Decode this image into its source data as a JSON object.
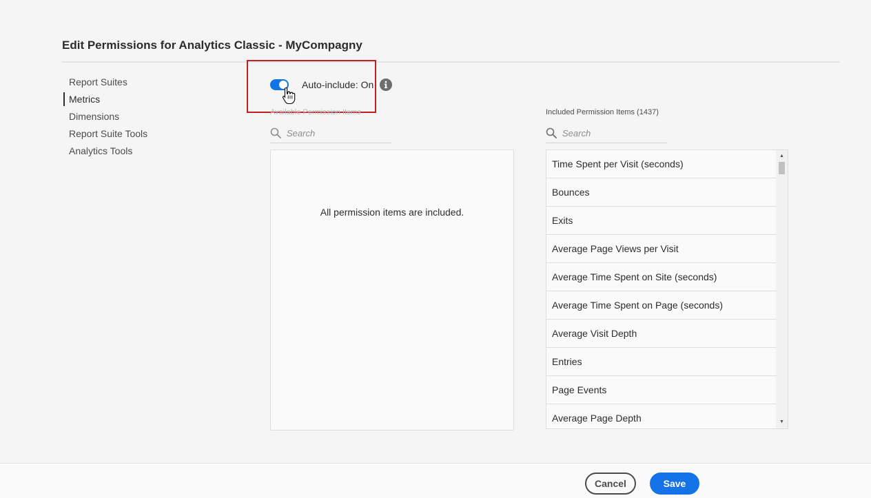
{
  "page": {
    "title": "Edit Permissions for Analytics Classic - MyCompagny"
  },
  "sidebar": {
    "items": [
      {
        "label": "Report Suites"
      },
      {
        "label": "Metrics",
        "active": true
      },
      {
        "label": "Dimensions"
      },
      {
        "label": "Report Suite Tools"
      },
      {
        "label": "Analytics Tools"
      }
    ]
  },
  "auto_include": {
    "label": "Auto-include: On",
    "state": "on"
  },
  "available": {
    "heading": "Available Permission Items",
    "search_placeholder": "Search",
    "empty_message": "All permission items are included."
  },
  "included": {
    "heading": "Included Permission Items (1437)",
    "search_placeholder": "Search",
    "items": [
      "Time Spent per Visit (seconds)",
      "Bounces",
      "Exits",
      "Average Page Views per Visit",
      "Average Time Spent on Site (seconds)",
      "Average Time Spent on Page (seconds)",
      "Average Visit Depth",
      "Entries",
      "Page Events",
      "Average Page Depth"
    ]
  },
  "footer": {
    "cancel_label": "Cancel",
    "save_label": "Save"
  },
  "colors": {
    "accent": "#1473e6",
    "highlight": "#c41f1f"
  }
}
